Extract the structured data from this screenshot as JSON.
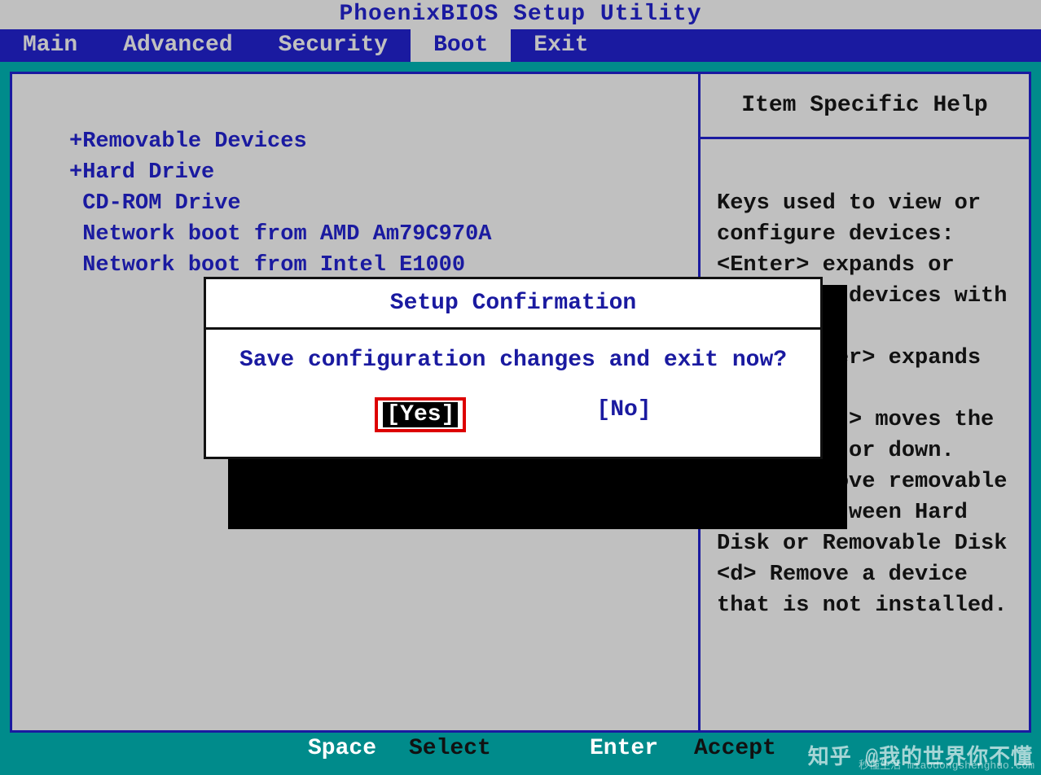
{
  "title": "PhoenixBIOS Setup Utility",
  "menu": {
    "items": [
      "Main",
      "Advanced",
      "Security",
      "Boot",
      "Exit"
    ],
    "active_index": 3
  },
  "boot": {
    "items": [
      "+Removable Devices",
      "+Hard Drive",
      " CD-ROM Drive",
      " Network boot from AMD Am79C970A",
      " Network boot from Intel E1000"
    ]
  },
  "help": {
    "title": "Item Specific Help",
    "body": "Keys used to view or\nconfigure devices:\n<Enter> expands or\ncollapses devices with\na + or -\n<Ctrl+Enter> expands\nall\n<+> and <-> moves the\ndevice up or down.\n<n> May move removable\ndevice between Hard\nDisk or Removable Disk\n<d> Remove a device\nthat is not installed."
  },
  "dialog": {
    "title": "Setup Confirmation",
    "message": "Save configuration changes and exit now?",
    "yes_label": "[Yes]",
    "no_label": "[No]"
  },
  "footer": {
    "key1": "Space",
    "action1": "Select",
    "key2": "Enter",
    "action2": "Accept"
  },
  "watermark": "知乎 @我的世界你不懂",
  "watermark_small": "秒懂生活 miaodongshenghuo.com"
}
